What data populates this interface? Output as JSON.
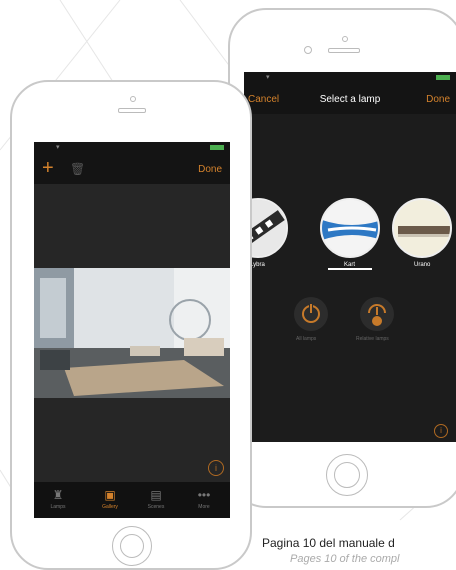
{
  "back_phone": {
    "nav": {
      "cancel": "Cancel",
      "title": "Select a lamp",
      "done": "Done"
    },
    "subtitle": "",
    "lamps": [
      {
        "label": "Lybra"
      },
      {
        "label": "Kart"
      },
      {
        "label": "Urano"
      }
    ],
    "actions": [
      {
        "label": "All lamps"
      },
      {
        "label": "Relative lamps"
      }
    ],
    "info_glyph": "i"
  },
  "front_phone": {
    "nav": {
      "add_glyph": "+",
      "trash_glyph": "🗑",
      "done": "Done"
    },
    "info_glyph": "i",
    "tabs": [
      {
        "label": "Lamps",
        "icon": "lamp-icon",
        "glyph": "♜"
      },
      {
        "label": "Gallery",
        "icon": "gallery-icon",
        "glyph": "▣",
        "active": true
      },
      {
        "label": "Scenes",
        "icon": "scenes-icon",
        "glyph": "▤"
      },
      {
        "label": "More",
        "icon": "more-icon",
        "glyph": "•••"
      }
    ]
  },
  "caption": {
    "line1": "Pagina 10 del manuale d",
    "line2": "Pages 10 of the compl"
  },
  "colors": {
    "accent": "#d4822c",
    "screen_bg": "#1c1c1c",
    "frame": "#c9c9c9"
  }
}
